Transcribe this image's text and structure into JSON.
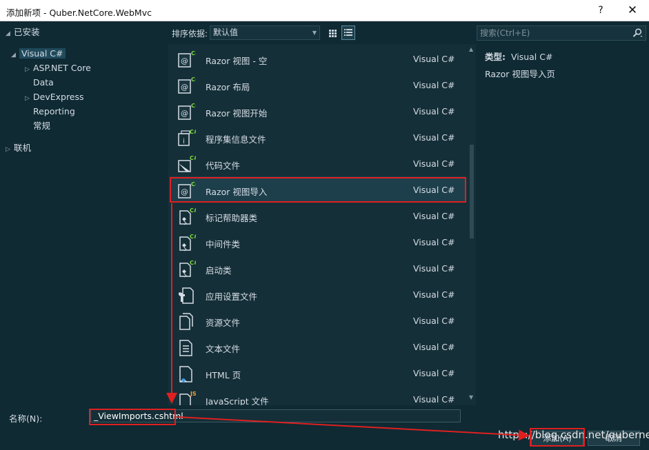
{
  "window": {
    "title": "添加新项 - Quber.NetCore.WebMvc",
    "help_label": "?",
    "close_label": "✕"
  },
  "tree": {
    "installed_label": "已安装",
    "visual_csharp": "Visual C#",
    "items": [
      "ASP.NET Core",
      "Data",
      "DevExpress",
      "Reporting",
      "常规"
    ],
    "online_label": "联机"
  },
  "toolbar": {
    "sort_label": "排序依据:",
    "sort_value": "默认值"
  },
  "templates": [
    {
      "name": "Razor 视图 - 空",
      "lang": "Visual C#",
      "icon": "razor-icon"
    },
    {
      "name": "Razor 布局",
      "lang": "Visual C#",
      "icon": "razor-icon"
    },
    {
      "name": "Razor 视图开始",
      "lang": "Visual C#",
      "icon": "razor-icon"
    },
    {
      "name": "程序集信息文件",
      "lang": "Visual C#",
      "icon": "info-file-icon"
    },
    {
      "name": "代码文件",
      "lang": "Visual C#",
      "icon": "code-file-icon"
    },
    {
      "name": "Razor 视图导入",
      "lang": "Visual C#",
      "icon": "razor-icon"
    },
    {
      "name": "标记帮助器类",
      "lang": "Visual C#",
      "icon": "class-file-icon"
    },
    {
      "name": "中间件类",
      "lang": "Visual C#",
      "icon": "class-file-icon"
    },
    {
      "name": "启动类",
      "lang": "Visual C#",
      "icon": "class-file-icon"
    },
    {
      "name": "应用设置文件",
      "lang": "Visual C#",
      "icon": "settings-file-icon"
    },
    {
      "name": "资源文件",
      "lang": "Visual C#",
      "icon": "resource-file-icon"
    },
    {
      "name": "文本文件",
      "lang": "Visual C#",
      "icon": "text-file-icon"
    },
    {
      "name": "HTML 页",
      "lang": "Visual C#",
      "icon": "html-file-icon"
    },
    {
      "name": "JavaScript 文件",
      "lang": "Visual C#",
      "icon": "js-file-icon"
    }
  ],
  "selected_index": 5,
  "search": {
    "placeholder": "搜索(Ctrl+E)"
  },
  "info": {
    "type_label": "类型:",
    "type_value": "Visual C#",
    "description": "Razor 视图导入页"
  },
  "name_field": {
    "label": "名称(N):",
    "value": "_ViewImports.cshtml"
  },
  "buttons": {
    "add": "添加(A)",
    "cancel": "取消"
  },
  "watermark": "https://blog.csdn.net/qubernet",
  "colors": {
    "annotation": "#e02020",
    "background": "#0f2a33",
    "list_bg": "#152f38",
    "csharp_badge": "#7ddc3e"
  }
}
